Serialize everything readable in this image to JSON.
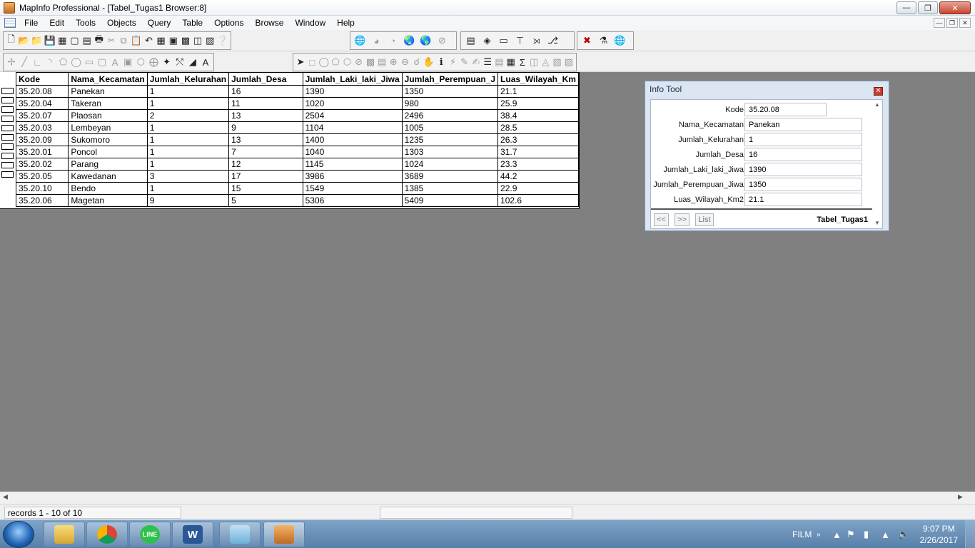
{
  "window": {
    "title": "MapInfo Professional - [Tabel_Tugas1 Browser:8]"
  },
  "menu": [
    "File",
    "Edit",
    "Tools",
    "Objects",
    "Query",
    "Table",
    "Options",
    "Browse",
    "Window",
    "Help"
  ],
  "table": {
    "columns": [
      "Kode",
      "Nama_Kecamatan",
      "Jumlah_Kelurahan",
      "Jumlah_Desa",
      "Jumlah_Laki_laki_Jiwa",
      "Jumlah_Perempuan_J",
      "Luas_Wilayah_Km"
    ],
    "rows": [
      [
        "35.20.08",
        "Panekan",
        "1",
        "16",
        "1390",
        "1350",
        "21.1"
      ],
      [
        "35.20.04",
        "Takeran",
        "1",
        "11",
        "1020",
        "980",
        "25.9"
      ],
      [
        "35.20.07",
        "Plaosan",
        "2",
        "13",
        "2504",
        "2496",
        "38.4"
      ],
      [
        "35.20.03",
        "Lembeyan",
        "1",
        "9",
        "1104",
        "1005",
        "28.5"
      ],
      [
        "35.20.09",
        "Sukomoro",
        "1",
        "13",
        "1400",
        "1235",
        "26.3"
      ],
      [
        "35.20.01",
        "Poncol",
        "1",
        "7",
        "1040",
        "1303",
        "31.7"
      ],
      [
        "35.20.02",
        "Parang",
        "1",
        "12",
        "1145",
        "1024",
        "23.3"
      ],
      [
        "35.20.05",
        "Kawedanan",
        "3",
        "17",
        "3986",
        "3689",
        "44.2"
      ],
      [
        "35.20.10",
        "Bendo",
        "1",
        "15",
        "1549",
        "1385",
        "22.9"
      ],
      [
        "35.20.06",
        "Magetan",
        "9",
        "5",
        "5306",
        "5409",
        "102.6"
      ]
    ]
  },
  "info_tool": {
    "title": "Info Tool",
    "fields": [
      {
        "label": "Kode:",
        "value": "35.20.08"
      },
      {
        "label": "Nama_Kecamatan:",
        "value": "Panekan"
      },
      {
        "label": "Jumlah_Kelurahan:",
        "value": "1"
      },
      {
        "label": "Jumlah_Desa:",
        "value": "16"
      },
      {
        "label": "Jumlah_Laki_laki_Jiwa:",
        "value": "1390"
      },
      {
        "label": "Jumlah_Perempuan_Jiwa:",
        "value": "1350"
      },
      {
        "label": "Luas_Wilayah_Km2:",
        "value": "21.1"
      }
    ],
    "prev_label": "<<",
    "next_label": ">>",
    "list_label": "List",
    "table_name": "Tabel_Tugas1"
  },
  "status": {
    "records": "records 1 - 10 of 10"
  },
  "taskbar": {
    "tray_label": "FILM",
    "time": "9:07 PM",
    "date": "2/26/2017"
  }
}
